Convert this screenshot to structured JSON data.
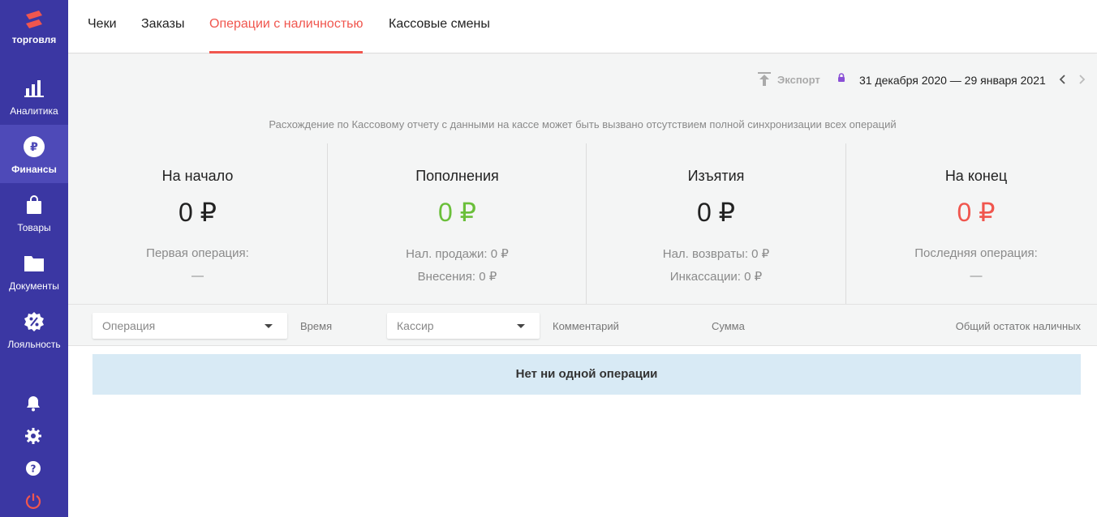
{
  "sidebar": {
    "logo_text": "торговля",
    "items": [
      {
        "label": "Аналитика",
        "icon": "bar-chart-icon"
      },
      {
        "label": "Финансы",
        "icon": "ruble-icon"
      },
      {
        "label": "Товары",
        "icon": "shopping-bag-icon"
      },
      {
        "label": "Документы",
        "icon": "folder-icon"
      },
      {
        "label": "Лояльность",
        "icon": "discount-icon"
      }
    ],
    "bottom_icons": [
      "bell-icon",
      "gear-icon",
      "help-icon",
      "power-icon"
    ]
  },
  "tabs": [
    {
      "label": "Чеки"
    },
    {
      "label": "Заказы"
    },
    {
      "label": "Операции с наличностью",
      "active": true
    },
    {
      "label": "Кассовые смены"
    }
  ],
  "toolbar": {
    "export_label": "Экспорт",
    "date_range": "31 декабря 2020 — 29 января 2021"
  },
  "notice": "Расхождение по Кассовому отчету с данными на кассе может быть вызвано отсутствием полной синхронизации всех операций",
  "summary": {
    "start": {
      "title": "На начало",
      "amount": "0 ₽",
      "sub1": "Первая операция:",
      "sub2": "—"
    },
    "deposits": {
      "title": "Пополнения",
      "amount": "0 ₽",
      "sub1": "Нал. продажи: 0 ₽",
      "sub2": "Внесения: 0 ₽"
    },
    "withdrawals": {
      "title": "Изъятия",
      "amount": "0 ₽",
      "sub1": "Нал. возвраты: 0 ₽",
      "sub2": "Инкассации: 0 ₽"
    },
    "end": {
      "title": "На конец",
      "amount": "0 ₽",
      "sub1": "Последняя операция:",
      "sub2": "—"
    }
  },
  "colors": {
    "sidebar": "#3b37a3",
    "accent": "#f0564e",
    "positive": "#6abf3a",
    "empty_bg": "#d8eaf5"
  },
  "filters": {
    "operation_placeholder": "Операция",
    "time_header": "Время",
    "cashier_placeholder": "Кассир",
    "comment_header": "Комментарий",
    "sum_header": "Сумма",
    "balance_header": "Общий остаток наличных"
  },
  "empty_message": "Нет ни одной операции"
}
